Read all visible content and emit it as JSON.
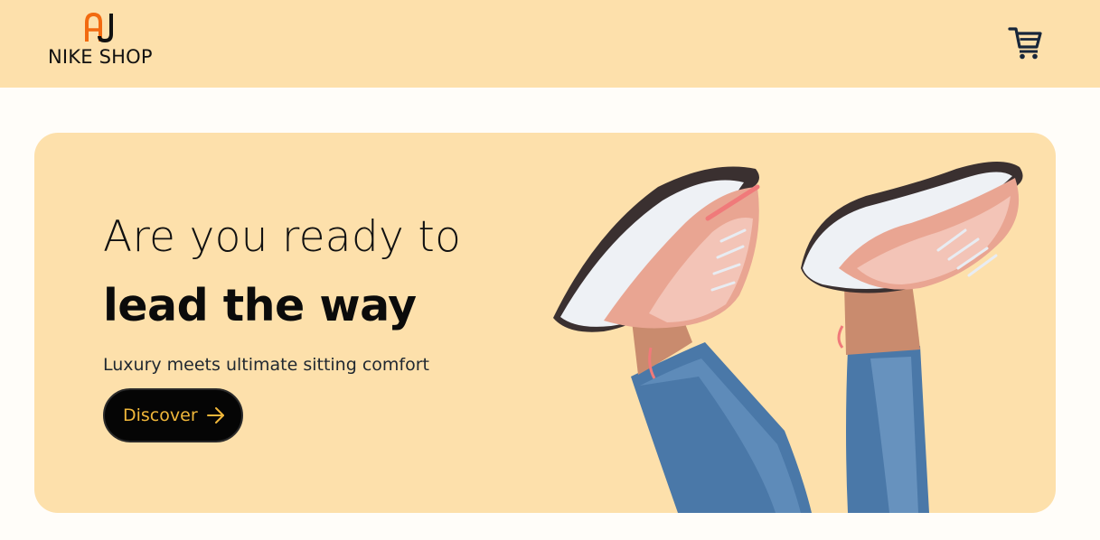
{
  "header": {
    "logo_mark": "AJ",
    "logo_text": "NIKE SHOP",
    "cart_icon": "shopping-cart-icon"
  },
  "hero": {
    "headline_line1": "Are you ready to",
    "headline_line2": "lead the way",
    "subtitle": "Luxury meets ultimate sitting comfort",
    "cta_label": "Discover",
    "cta_icon": "arrow-right-icon",
    "image": "sneakers-on-feet-illustration"
  },
  "colors": {
    "header_bg": "#fde0ab",
    "page_bg": "#fffdf9",
    "hero_bg": "#fde0ab",
    "logo_orange": "#f26a10",
    "cta_bg": "#050505",
    "cta_text": "#f0b73a",
    "icon_dark": "#17263a"
  }
}
